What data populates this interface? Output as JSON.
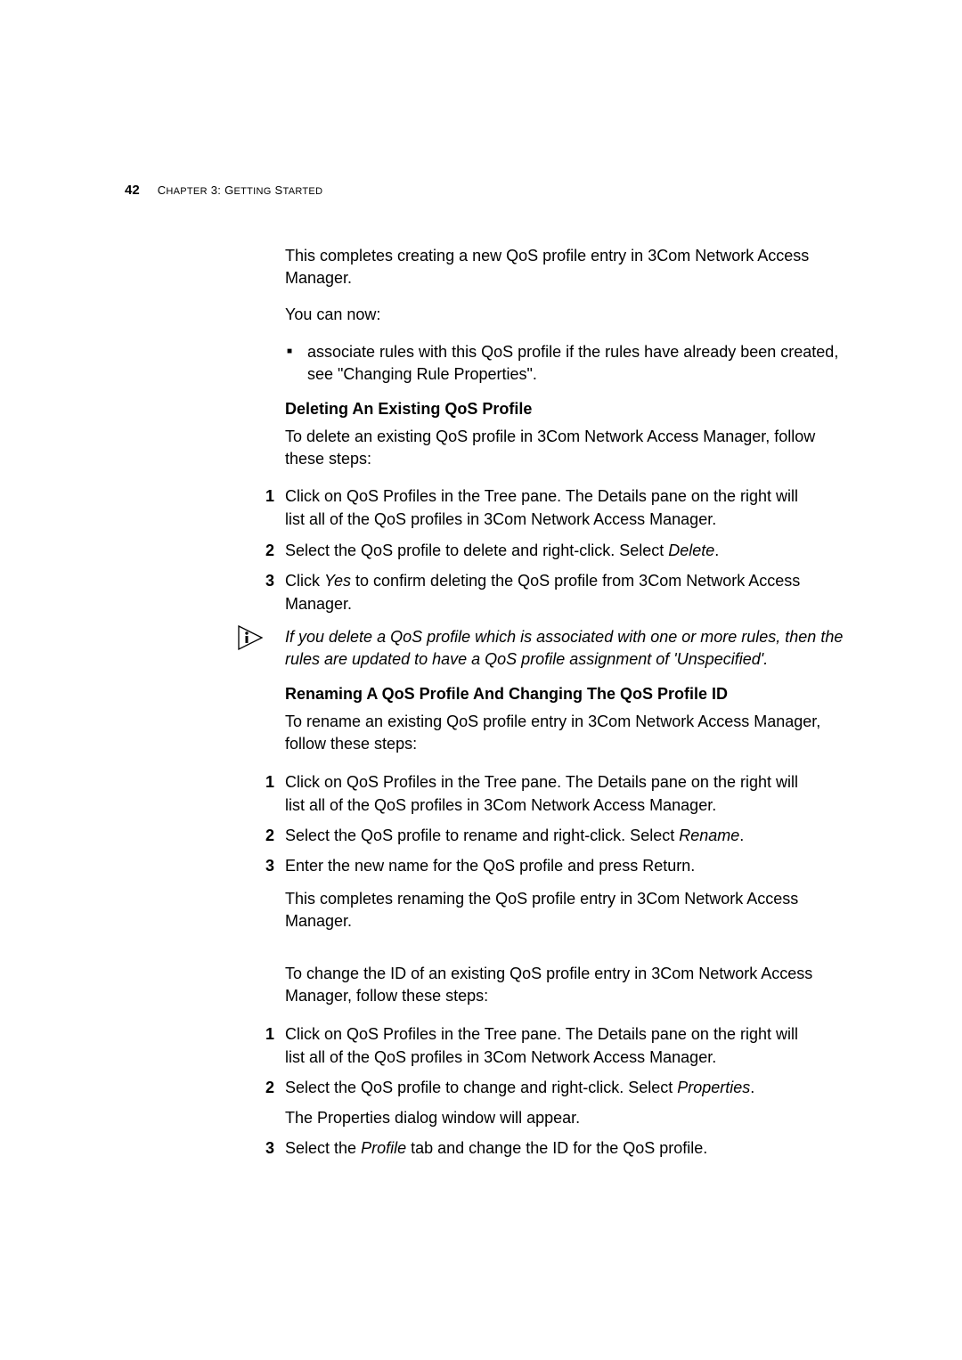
{
  "header": {
    "page_number": "42",
    "chapter_label_prefix": "C",
    "chapter_label_rest": "HAPTER",
    "chapter_label_num": " 3: G",
    "chapter_label_rest2": "ETTING",
    "chapter_label_s": " S",
    "chapter_label_rest3": "TARTED"
  },
  "intro": {
    "p1": "This completes creating a new QoS profile entry in 3Com Network Access Manager.",
    "p2": "You can now:",
    "bullet1": "associate rules with this QoS profile if the rules have already been created, see \"Changing Rule Properties\"."
  },
  "section_delete": {
    "heading": "Deleting An Existing QoS Profile",
    "intro": "To delete an existing QoS profile in 3Com Network Access Manager, follow these steps:",
    "steps": {
      "n1": "1",
      "t1a": "Click on QoS Profiles in the Tree pane. The Details pane on the right will",
      "t1b": "list all of the QoS profiles in 3Com Network Access Manager.",
      "n2": "2",
      "t2a": "Select the QoS profile to delete and right-click. Select ",
      "t2i": "Delete",
      "t2b": ".",
      "n3": "3",
      "t3a": "Click ",
      "t3i": "Yes",
      "t3b": " to confirm deleting the QoS profile from 3Com Network Access",
      "t3c": "Manager."
    },
    "info": "If you delete a QoS profile which is associated with one or more rules, then the rules are updated to have a QoS profile assignment of 'Unspecified'."
  },
  "section_rename": {
    "heading": "Renaming A QoS Profile And Changing The QoS Profile ID",
    "intro": "To rename an existing QoS profile entry in 3Com Network Access Manager, follow these steps:",
    "steps1": {
      "n1": "1",
      "t1a": "Click on QoS Profiles in the Tree pane. The Details pane on the right will",
      "t1b": "list all of the QoS profiles in 3Com Network Access Manager.",
      "n2": "2",
      "t2a": "Select the QoS profile to rename and right-click. Select ",
      "t2i": "Rename",
      "t2b": ".",
      "n3": "3",
      "t3": "Enter the new name for the QoS profile and press Return."
    },
    "p_after1": "This completes renaming the QoS profile entry in 3Com Network Access Manager.",
    "intro2": "To change the ID of an existing QoS profile entry in 3Com Network Access Manager, follow these steps:",
    "steps2": {
      "n1": "1",
      "t1a": "Click on QoS Profiles in the Tree pane. The Details pane on the right will",
      "t1b": "list all of the QoS profiles in 3Com Network Access Manager.",
      "n2": "2",
      "t2a": "Select the QoS profile to change and right-click. Select ",
      "t2i": "Properties",
      "t2b": ".",
      "t2c": "The Properties dialog window will appear.",
      "n3": "3",
      "t3a": "Select the ",
      "t3i": "Profile",
      "t3b": " tab and change the ID for the QoS profile."
    }
  }
}
